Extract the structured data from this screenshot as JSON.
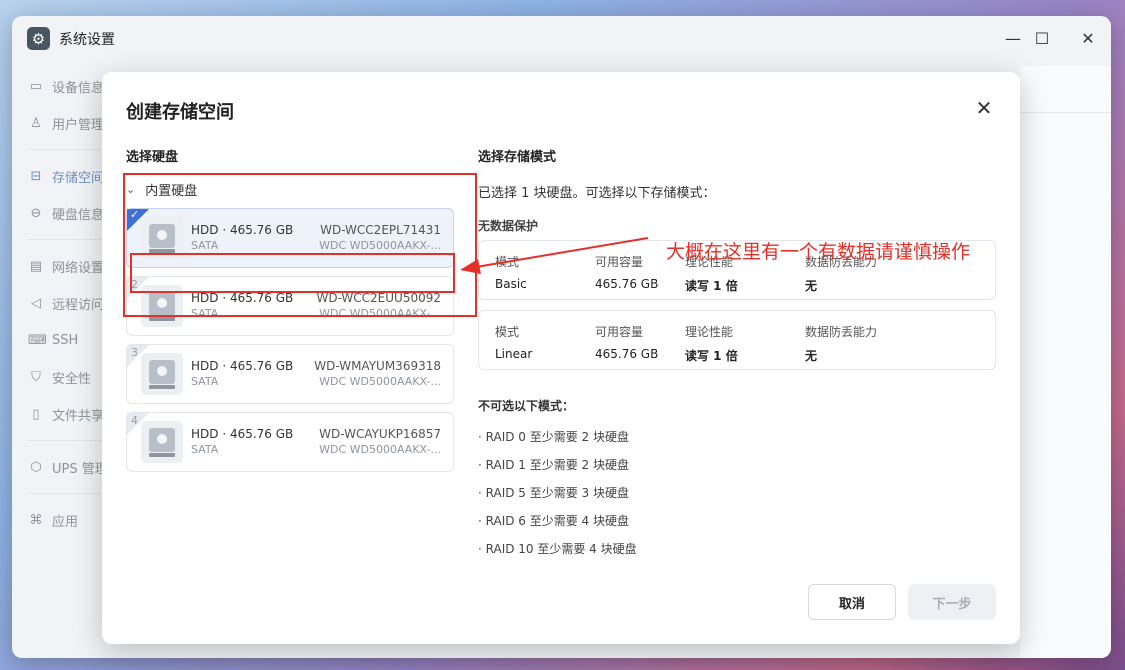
{
  "window": {
    "title": "系统设置",
    "icon": "gear-icon",
    "controls": [
      "minimize-icon",
      "maximize-icon",
      "close-icon"
    ]
  },
  "sidebar": {
    "items": [
      {
        "label": "设备信息",
        "icon": "device-icon"
      },
      {
        "label": "用户管理",
        "icon": "user-icon"
      },
      {
        "label": "存储空间",
        "icon": "storage-icon",
        "active": true
      },
      {
        "label": "硬盘信息",
        "icon": "disk-icon"
      },
      {
        "label": "网络设置",
        "icon": "network-icon"
      },
      {
        "label": "远程访问",
        "icon": "remote-icon"
      },
      {
        "label": "SSH",
        "icon": "ssh-icon"
      },
      {
        "label": "安全性",
        "icon": "shield-icon"
      },
      {
        "label": "文件共享",
        "icon": "file-share-icon"
      },
      {
        "label": "UPS 管理",
        "icon": "ups-icon"
      },
      {
        "label": "应用",
        "icon": "apps-icon"
      }
    ]
  },
  "dialog": {
    "title": "创建存储空间",
    "left": {
      "section": "选择硬盘",
      "group": "内置硬盘",
      "disks": [
        {
          "index": "1",
          "selected": true,
          "spec": "HDD · 465.76 GB",
          "bus": "SATA",
          "serial": "WD-WCC2EPL71431",
          "model": "WDC WD5000AAKX-..."
        },
        {
          "index": "2",
          "selected": false,
          "spec": "HDD · 465.76 GB",
          "bus": "SATA",
          "serial": "WD-WCC2EUU50092",
          "model": "WDC WD5000AAKX-..."
        },
        {
          "index": "3",
          "selected": false,
          "spec": "HDD · 465.76 GB",
          "bus": "SATA",
          "serial": "WD-WMAYUM369318",
          "model": "WDC WD5000AAKX-..."
        },
        {
          "index": "4",
          "selected": false,
          "spec": "HDD · 465.76 GB",
          "bus": "SATA",
          "serial": "WD-WCAYUKP16857",
          "model": "WDC WD5000AAKX-..."
        }
      ]
    },
    "right": {
      "section": "选择存储模式",
      "hint": "已选择 1 块硬盘。可选择以下存储模式：",
      "no_protection": "无数据保护",
      "headers": {
        "mode": "模式",
        "capacity": "可用容量",
        "performance": "理论性能",
        "loss": "数据防丢能力"
      },
      "modes": [
        {
          "mode": "Basic",
          "capacity": "465.76 GB",
          "performance": "读写 1 倍",
          "loss": "无"
        },
        {
          "mode": "Linear",
          "capacity": "465.76 GB",
          "performance": "读写 1 倍",
          "loss": "无"
        }
      ],
      "unavailable_title": "不可选以下模式：",
      "unavailable": [
        "· RAID 0   至少需要 2 块硬盘",
        "· RAID 1   至少需要 2 块硬盘",
        "· RAID 5   至少需要 3 块硬盘",
        "· RAID 6   至少需要 4 块硬盘",
        "· RAID 10   至少需要 4 块硬盘"
      ]
    },
    "buttons": {
      "cancel": "取消",
      "next": "下一步"
    }
  },
  "annotation": {
    "text": "大概在这里有一个有数据请谨慎操作",
    "color": "#e5302a"
  }
}
